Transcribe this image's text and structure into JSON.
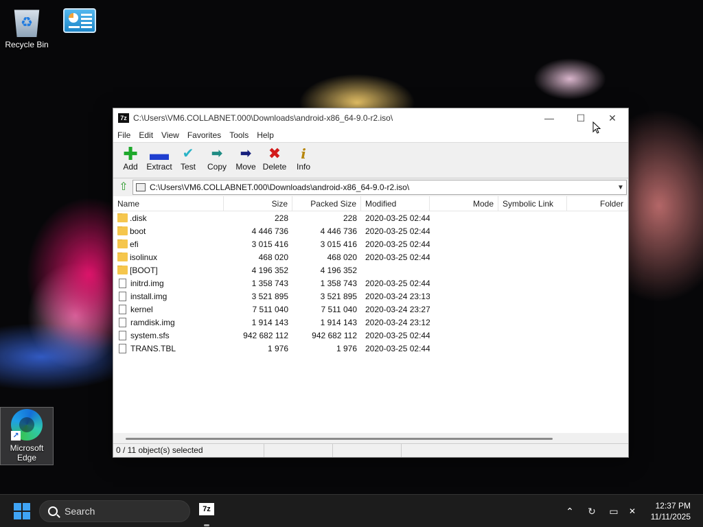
{
  "desktop": {
    "icons": [
      {
        "label": "Recycle Bin"
      },
      {
        "label": ""
      },
      {
        "label": "Microsoft Edge"
      }
    ]
  },
  "window": {
    "title": "C:\\Users\\VM6.COLLABNET.000\\Downloads\\android-x86_64-9.0-r2.iso\\",
    "app_icon": "7z",
    "controls": {
      "minimize": "—",
      "maximize": "☐",
      "close": "✕"
    },
    "menu": [
      "File",
      "Edit",
      "View",
      "Favorites",
      "Tools",
      "Help"
    ],
    "toolbar": [
      {
        "label": "Add",
        "icon": "plus-icon",
        "glyph": "✚"
      },
      {
        "label": "Extract",
        "icon": "minus-icon",
        "glyph": "▬"
      },
      {
        "label": "Test",
        "icon": "check-icon",
        "glyph": "✔"
      },
      {
        "label": "Copy",
        "icon": "copy-arrow-icon",
        "glyph": "➡"
      },
      {
        "label": "Move",
        "icon": "move-arrow-icon",
        "glyph": "➡"
      },
      {
        "label": "Delete",
        "icon": "delete-x-icon",
        "glyph": "✖"
      },
      {
        "label": "Info",
        "icon": "info-icon",
        "glyph": "i"
      }
    ],
    "address": "C:\\Users\\VM6.COLLABNET.000\\Downloads\\android-x86_64-9.0-r2.iso\\",
    "columns": [
      "Name",
      "Size",
      "Packed Size",
      "Modified",
      "Mode",
      "Symbolic Link",
      "Folder"
    ],
    "rows": [
      {
        "name": ".disk",
        "type": "folder",
        "size": "228",
        "packed": "228",
        "modified": "2020-03-25 02:44"
      },
      {
        "name": "boot",
        "type": "folder",
        "size": "4 446 736",
        "packed": "4 446 736",
        "modified": "2020-03-25 02:44"
      },
      {
        "name": "efi",
        "type": "folder",
        "size": "3 015 416",
        "packed": "3 015 416",
        "modified": "2020-03-25 02:44"
      },
      {
        "name": "isolinux",
        "type": "folder",
        "size": "468 020",
        "packed": "468 020",
        "modified": "2020-03-25 02:44"
      },
      {
        "name": "[BOOT]",
        "type": "folder",
        "size": "4 196 352",
        "packed": "4 196 352",
        "modified": ""
      },
      {
        "name": "initrd.img",
        "type": "file",
        "size": "1 358 743",
        "packed": "1 358 743",
        "modified": "2020-03-25 02:44"
      },
      {
        "name": "install.img",
        "type": "file",
        "size": "3 521 895",
        "packed": "3 521 895",
        "modified": "2020-03-24 23:13"
      },
      {
        "name": "kernel",
        "type": "file",
        "size": "7 511 040",
        "packed": "7 511 040",
        "modified": "2020-03-24 23:27"
      },
      {
        "name": "ramdisk.img",
        "type": "file",
        "size": "1 914 143",
        "packed": "1 914 143",
        "modified": "2020-03-24 23:12"
      },
      {
        "name": "system.sfs",
        "type": "file",
        "size": "942 682 112",
        "packed": "942 682 112",
        "modified": "2020-03-25 02:44"
      },
      {
        "name": "TRANS.TBL",
        "type": "file",
        "size": "1 976",
        "packed": "1 976",
        "modified": "2020-03-25 02:44"
      }
    ],
    "status": [
      "0 / 11 object(s) selected",
      "",
      "",
      ""
    ]
  },
  "taskbar": {
    "search_placeholder": "Search",
    "pinned": [
      {
        "label": "7z",
        "icon": "7zip-icon"
      }
    ],
    "tray": {
      "chevron": "⌃",
      "network": "↻",
      "display": "▭",
      "volume": "✕"
    },
    "time": "12:37 PM",
    "date": "11/11/2025"
  }
}
